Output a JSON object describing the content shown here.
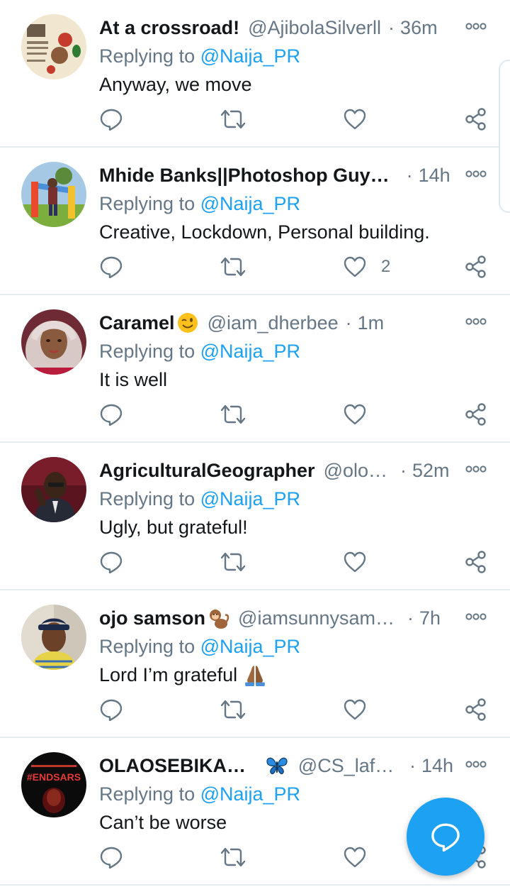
{
  "feed": {
    "tweets": [
      {
        "name": "At a crossroad!",
        "name_emoji": "",
        "handle": "@AjibolaSilverll",
        "time": "36m",
        "replying_prefix": "Replying to ",
        "replying_to": "@Naija_PR",
        "text": "Anyway, we move",
        "text_emoji": "",
        "likes": ""
      },
      {
        "name": "Mhide Banks||Photoshop Guy…",
        "name_emoji": "",
        "handle": "",
        "time": "14h",
        "replying_prefix": "Replying to ",
        "replying_to": "@Naija_PR",
        "text": "Creative, Lockdown, Personal building.",
        "text_emoji": "",
        "likes": "2"
      },
      {
        "name": "Caramel",
        "name_emoji": "winking-face",
        "handle": "@iam_dherbee",
        "time": "1m",
        "replying_prefix": "Replying to ",
        "replying_to": "@Naija_PR",
        "text": "It is well",
        "text_emoji": "",
        "likes": ""
      },
      {
        "name": "AgriculturalGeographer",
        "name_emoji": "",
        "handle": "@olo…",
        "time": "52m",
        "replying_prefix": "Replying to ",
        "replying_to": "@Naija_PR",
        "text": "Ugly, but grateful!",
        "text_emoji": "",
        "likes": ""
      },
      {
        "name": "ojo samson",
        "name_emoji": "monkey",
        "handle": "@iamsunnysam…",
        "time": "7h",
        "replying_prefix": "Replying to ",
        "replying_to": "@Naija_PR",
        "text": "Lord I’m grateful",
        "text_emoji": "folded-hands",
        "likes": ""
      },
      {
        "name": "OLAOSEBIKAN™",
        "name_emoji": "butterfly",
        "handle": "@CS_lafl…",
        "time": "14h",
        "replying_prefix": "Replying to ",
        "replying_to": "@Naija_PR",
        "text": "Can’t be worse",
        "text_emoji": "",
        "likes": ""
      }
    ],
    "separator": "·",
    "avatar_6_badge": "#ENDSARS"
  },
  "icons": {
    "reply": "reply-icon",
    "retweet": "retweet-icon",
    "like": "heart-icon",
    "share": "share-icon",
    "more": "more-icon",
    "compose": "compose-reply-icon"
  },
  "colors": {
    "accent": "#1da1f2",
    "text": "#14171a",
    "muted": "#657786",
    "divider": "#e6ecf0"
  }
}
